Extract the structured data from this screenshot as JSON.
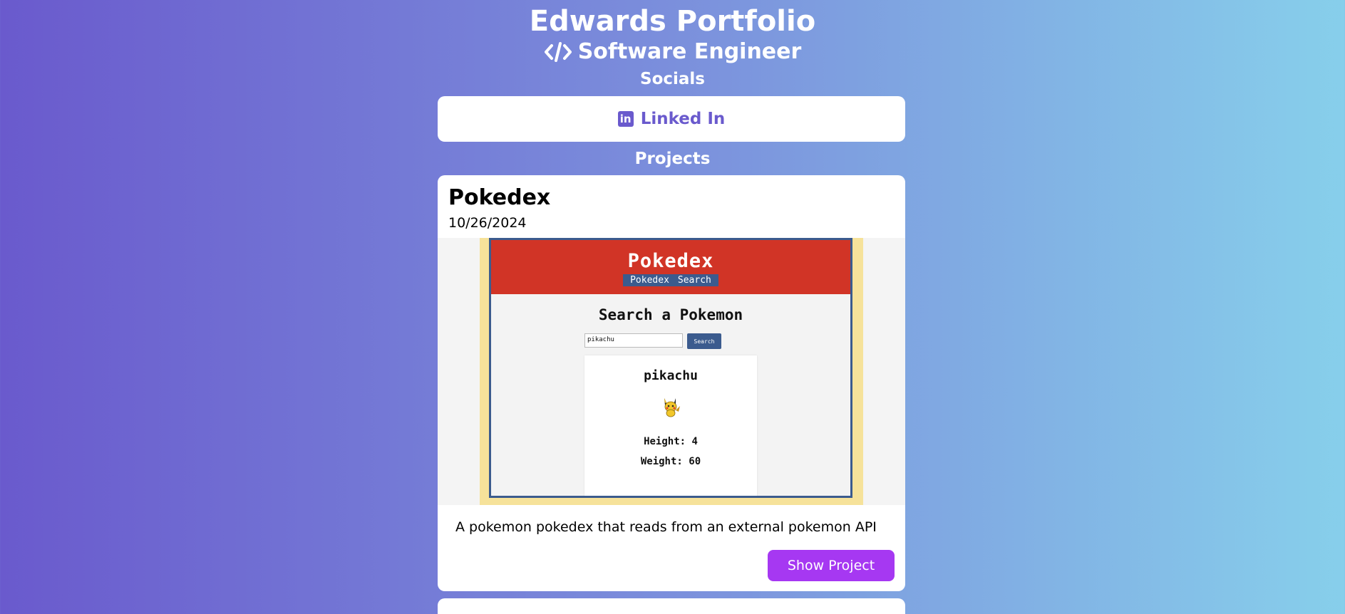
{
  "header": {
    "title": "Edwards Portfolio",
    "subtitle": "Software Engineer",
    "subtitle_icon": "code-icon"
  },
  "socials": {
    "title": "Socials",
    "links": [
      {
        "label": "Linked In",
        "icon": "linkedin-icon"
      }
    ]
  },
  "projects": {
    "title": "Projects",
    "items": [
      {
        "name": "Pokedex",
        "date": "10/26/2024",
        "description": "A pokemon pokedex that reads from an external pokemon API",
        "button_label": "Show Project",
        "preview": {
          "app_title": "Pokedex",
          "nav": [
            "Pokedex",
            "Search"
          ],
          "search_heading": "Search a Pokemon",
          "search_value": "pikachu",
          "search_button": "Search",
          "result_name": "pikachu",
          "height_text": "Height: 4",
          "weight_text": "Weight: 60"
        }
      }
    ]
  },
  "colors": {
    "gradient_start": "#6a5acd",
    "gradient_end": "#87cfeb",
    "accent": "#6a5acd",
    "button": "#a638f2",
    "pokedex_red": "#d13426",
    "pokedex_blue": "#3b5b8e"
  }
}
